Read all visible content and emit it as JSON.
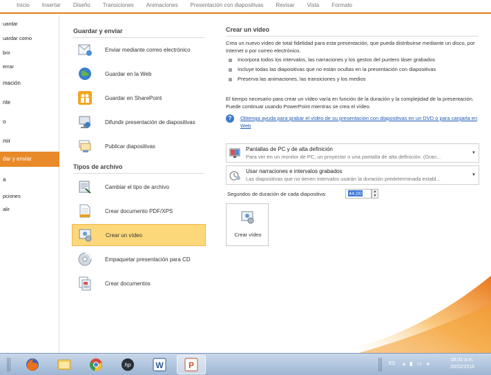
{
  "ribbon": {
    "tabs": [
      "Inicio",
      "Insertar",
      "Diseño",
      "Transiciones",
      "Animaciones",
      "Presentación con diapositivas",
      "Revisar",
      "Vista",
      "Formato"
    ]
  },
  "left_menu": {
    "items": [
      "uardar",
      "uardar como",
      "brir",
      "errar",
      "mación",
      "nte",
      "o",
      "mir",
      "dar y enviar",
      "a",
      "pciones",
      "alir"
    ]
  },
  "middle": {
    "section1_title": "Guardar y enviar",
    "section1_items": [
      {
        "label": "Enviar mediante correo electrónico",
        "icon": "email-icon"
      },
      {
        "label": "Guardar en la Web",
        "icon": "globe-icon"
      },
      {
        "label": "Guardar en SharePoint",
        "icon": "sharepoint-icon"
      },
      {
        "label": "Difundir presentación de diapositivas",
        "icon": "broadcast-icon"
      },
      {
        "label": "Publicar diapositivas",
        "icon": "publish-slides-icon"
      }
    ],
    "section2_title": "Tipos de archivo",
    "section2_items": [
      {
        "label": "Cambiar el tipo de archivo",
        "icon": "change-filetype-icon"
      },
      {
        "label": "Crear documento PDF/XPS",
        "icon": "pdf-document-icon"
      },
      {
        "label": "Crear un vídeo",
        "icon": "video-icon"
      },
      {
        "label": "Empaquetar presentación para CD",
        "icon": "cd-icon"
      },
      {
        "label": "Crear documentos",
        "icon": "documents-icon"
      }
    ]
  },
  "right": {
    "title": "Crear un vídeo",
    "intro": "Crea un nuevo vídeo de total fidelidad para esta presentación, que pueda distribuirse mediante un disco, por Internet o por correo electrónico.",
    "bullets": [
      "Incorpora todos los intervalos, las narraciones y los gestos del puntero láser grabados",
      "Incluye todas las diapositivas que no están ocultas en la presentación con diapositivas",
      "Preserva las animaciones, las transiciones y los medios"
    ],
    "time_note": "El tiempo necesario para crear un vídeo varía en función de la duración y la complejidad de la presentación. Puede continuar usando PowerPoint mientras se crea el vídeo.",
    "help_link": "Obtenga ayuda para grabar el vídeo de su presentación con diapositivas en un DVD o para cargarla en Web",
    "dropdown1": {
      "title": "Pantallas de PC y de alta definición",
      "subtitle": "Para ver en un monitor de PC, un proyector o una pantalla de alta definición. (Gran..."
    },
    "dropdown2": {
      "title": "Usar narraciones e intervalos grabados",
      "subtitle": "Las diapositivas que no tienen intervalos usarán la duración predeterminada establ..."
    },
    "duration_label": "Segundos de duración de cada diapositiva:",
    "duration_value": "44,00",
    "create_button": "Crear vídeo"
  },
  "taskbar": {
    "apps": [
      "firefox-icon",
      "file-explorer-icon",
      "chrome-icon",
      "hp-icon",
      "word-icon",
      "powerpoint-icon"
    ],
    "language": "ES",
    "time": "05:31 a.m.",
    "date": "20/02/2016"
  },
  "colors": {
    "accent_orange": "#e98a2a",
    "selected_item": "#fdd87a",
    "link_blue": "#1d59b7"
  }
}
